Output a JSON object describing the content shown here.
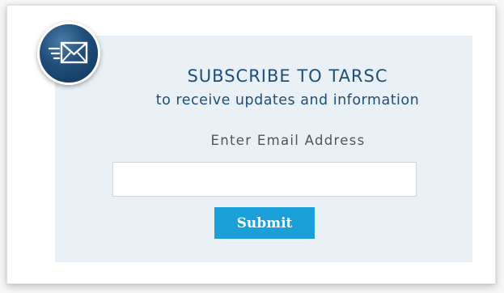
{
  "widget": {
    "title": "SUBSCRIBE TO TARSC",
    "subtitle": "to receive updates and information",
    "email_label": "Enter Email Address",
    "email_value": "",
    "email_placeholder": "",
    "submit_label": "Submit",
    "icon": "envelope-icon"
  },
  "colors": {
    "heading": "#1f4e79",
    "panel_background": "#e9f0f6",
    "button_background": "#1a9fd8",
    "badge": "#1f4d7a"
  }
}
